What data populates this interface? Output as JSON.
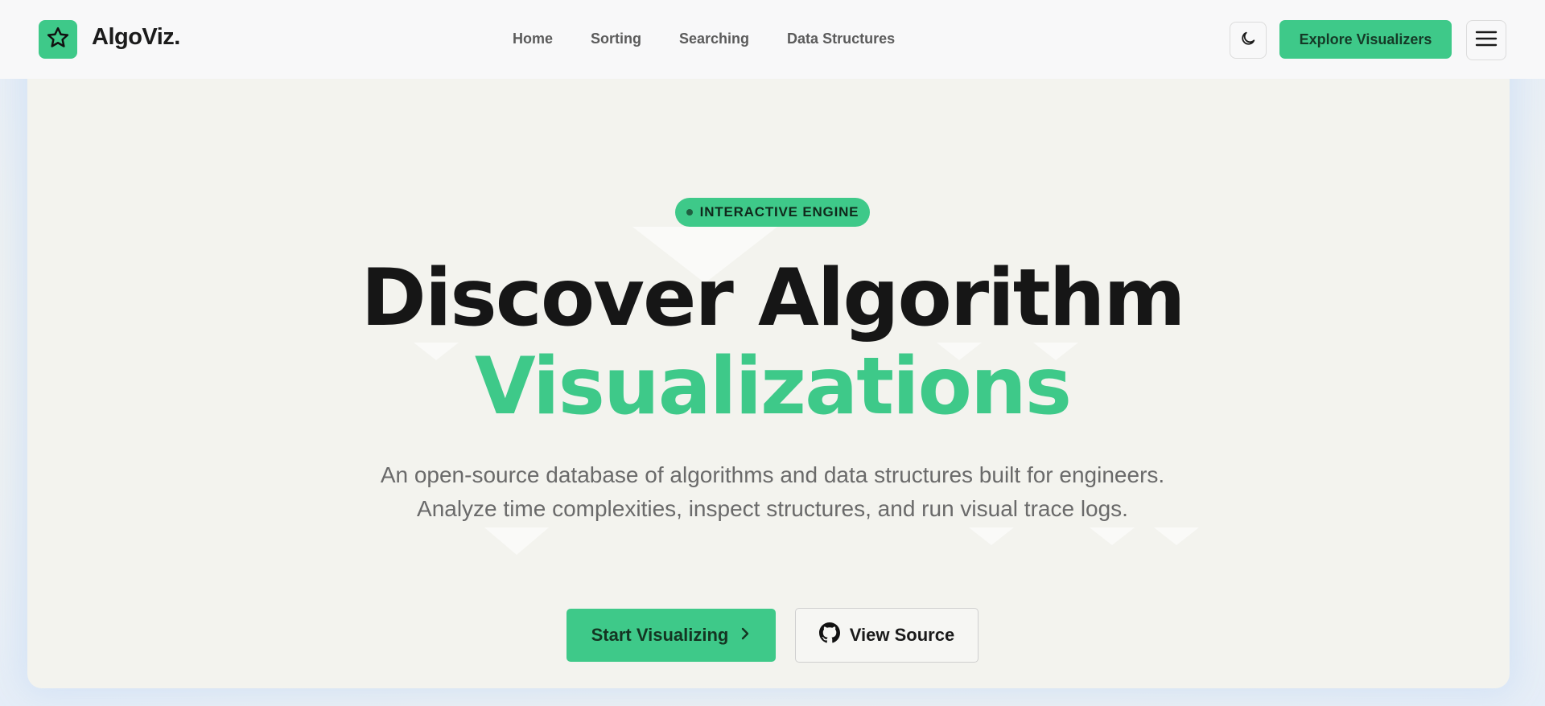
{
  "brand": {
    "name": "AlgoViz.",
    "accent_color": "#3ec989",
    "logo_icon": "star-icon"
  },
  "nav": {
    "items": [
      "Home",
      "Sorting",
      "Searching",
      "Data Structures"
    ]
  },
  "header_actions": {
    "theme_icon": "moon-icon",
    "explore_label": "Explore Visualizers",
    "menu_icon": "hamburger-menu-icon"
  },
  "hero": {
    "badge": "INTERACTIVE ENGINE",
    "title_line1": "Discover Algorithm",
    "title_line2": "Visualizations",
    "subtitle": "An open-source database of algorithms and data structures built for engineers. Analyze time complexities, inspect structures, and run visual trace logs.",
    "primary_cta": "Start Visualizing",
    "primary_cta_icon": "chevron-right-icon",
    "secondary_cta": "View Source",
    "secondary_cta_icon": "github-icon"
  }
}
